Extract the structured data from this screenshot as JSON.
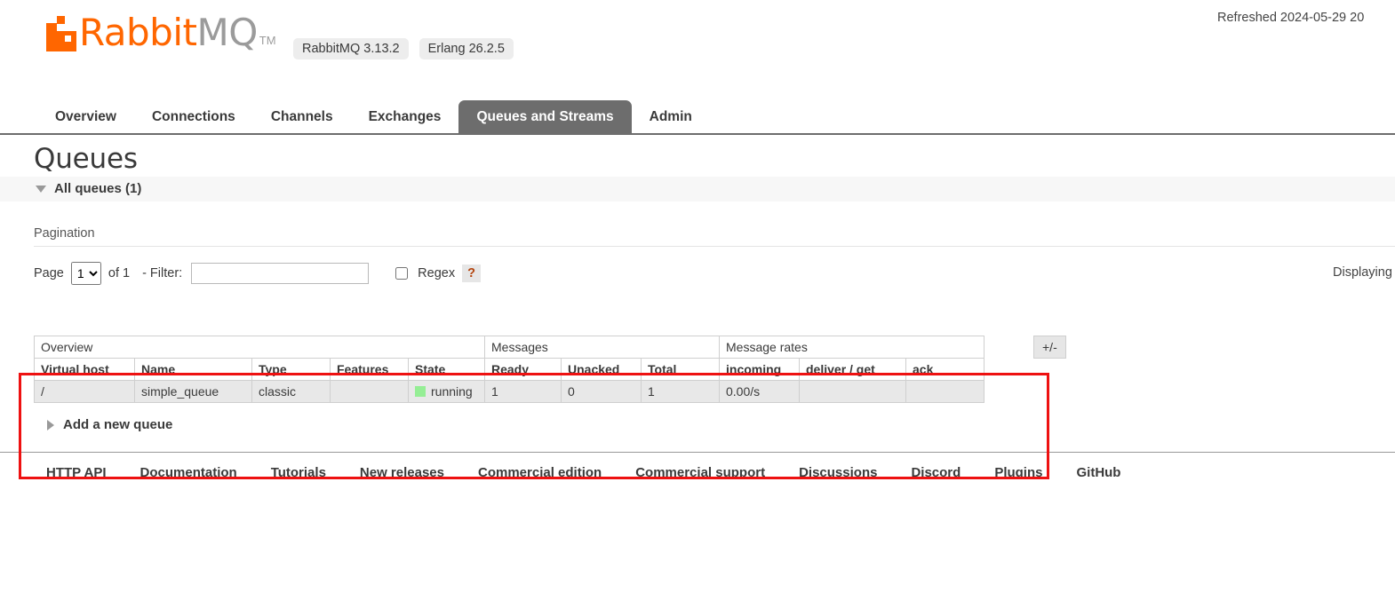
{
  "header": {
    "refresh_status": "Refreshed 2024-05-29 20",
    "logo_primary": "Rabbit",
    "logo_secondary": "MQ",
    "logo_tm": "TM",
    "badges": [
      "RabbitMQ 3.13.2",
      "Erlang 26.2.5"
    ]
  },
  "nav": {
    "tabs": [
      {
        "label": "Overview",
        "active": false
      },
      {
        "label": "Connections",
        "active": false
      },
      {
        "label": "Channels",
        "active": false
      },
      {
        "label": "Exchanges",
        "active": false
      },
      {
        "label": "Queues and Streams",
        "active": true
      },
      {
        "label": "Admin",
        "active": false
      }
    ]
  },
  "main": {
    "page_title": "Queues",
    "all_queues_label": "All queues (1)",
    "pagination_label": "Pagination",
    "displaying_text": "Displaying",
    "add_queue_label": "Add a new queue"
  },
  "pagination": {
    "page_label": "Page",
    "page_value": "1",
    "page_options": [
      "1"
    ],
    "of_label": "of 1",
    "filter_label": "- Filter:",
    "filter_value": "",
    "filter_placeholder": "",
    "regex_label": "Regex",
    "regex_help": "?",
    "regex_checked": false
  },
  "table": {
    "groups": [
      {
        "label": "Overview",
        "span": 5
      },
      {
        "label": "Messages",
        "span": 3
      },
      {
        "label": "Message rates",
        "span": 3
      }
    ],
    "columns": [
      "Virtual host",
      "Name",
      "Type",
      "Features",
      "State",
      "Ready",
      "Unacked",
      "Total",
      "incoming",
      "deliver / get",
      "ack"
    ],
    "rows": [
      {
        "virtual_host": "/",
        "name": "simple_queue",
        "type": "classic",
        "features": "",
        "state": "running",
        "state_color": "#95ee95",
        "ready": "1",
        "unacked": "0",
        "total": "1",
        "incoming": "0.00/s",
        "deliver_get": "",
        "ack": ""
      }
    ],
    "toggle_columns_label": "+/-",
    "highlight_color": "#ee1111"
  },
  "footer": {
    "links": [
      "HTTP API",
      "Documentation",
      "Tutorials",
      "New releases",
      "Commercial edition",
      "Commercial support",
      "Discussions",
      "Discord",
      "Plugins",
      "GitHub"
    ]
  }
}
